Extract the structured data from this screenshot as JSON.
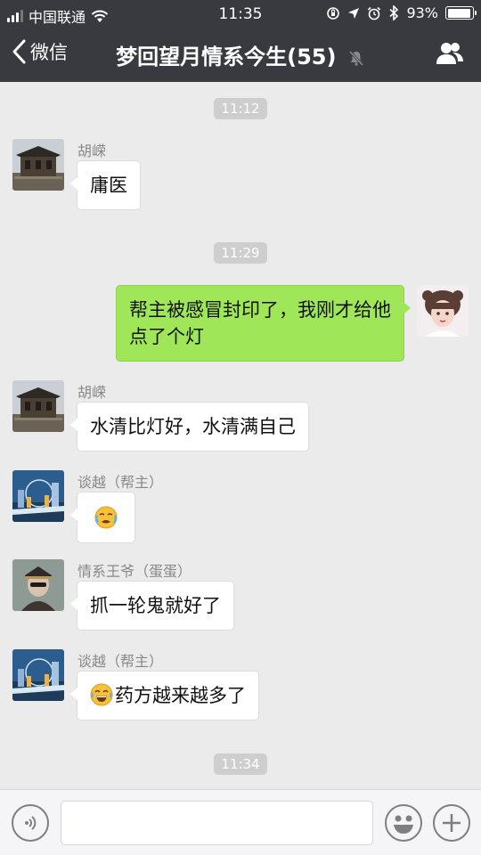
{
  "status_bar": {
    "carrier": "中国联通",
    "time": "11:35",
    "battery": "93%",
    "battery_level": 0.93
  },
  "nav": {
    "back_label": "微信",
    "title": "梦回望月情系今生(55)"
  },
  "messages": [
    {
      "time": "11:12"
    },
    {
      "sender": "胡嵘",
      "text": "庸医",
      "side": "left"
    },
    {
      "time": "11:29"
    },
    {
      "text_line1": "帮主被感冒封印了，我刚才给他",
      "text_line2": "点了个灯",
      "side": "right"
    },
    {
      "sender": "胡嵘",
      "text": "水清比灯好，水清满自己",
      "side": "left"
    },
    {
      "sender": "谈越（帮主）",
      "emoji": "crying-face-emoji",
      "side": "left"
    },
    {
      "sender": "情系王爷（蛋蛋）",
      "text": "抓一轮鬼就好了",
      "side": "left"
    },
    {
      "sender": "谈越（帮主）",
      "emoji": "tears-of-joy-emoji",
      "text": "药方越来越多了",
      "side": "left"
    },
    {
      "time": "11:34"
    }
  ],
  "input": {
    "value": "",
    "placeholder": ""
  },
  "colors": {
    "header": "#393a3f",
    "background": "#ebebeb",
    "own_bubble": "#9fe658",
    "other_bubble": "#ffffff"
  }
}
